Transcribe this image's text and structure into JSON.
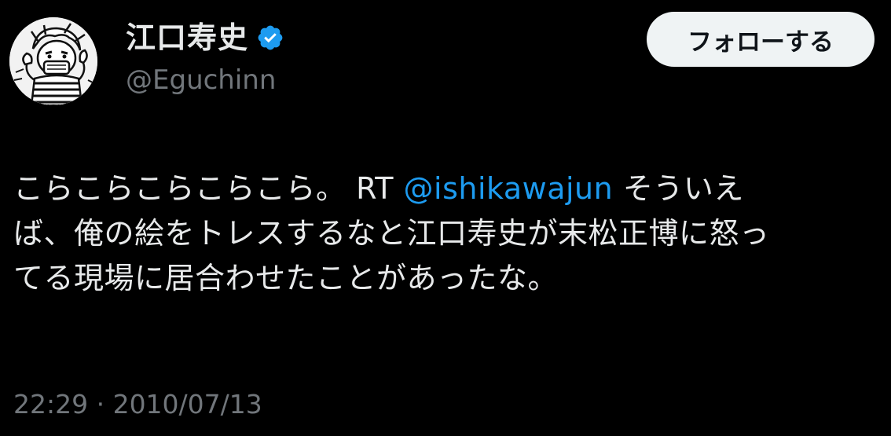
{
  "author": {
    "display_name": "江口寿史",
    "handle": "@Eguchinn",
    "avatar_icon": "manga-character-avatar",
    "verified_icon": "verified-badge-icon",
    "verified_color": "#1d9bf0"
  },
  "follow_button": {
    "label": "フォローする"
  },
  "tweet": {
    "line1_text": "こらこらこらこらこら。 RT ",
    "line1_mention": "@ishikawajun",
    "line1_tail": " そういえ",
    "line2": "ば、俺の絵をトレスするなと江口寿史が末松正博に怒っ",
    "line3": "てる現場に居合わせたことがあったな。"
  },
  "timestamp": "22:29 · 2010/07/13",
  "colors": {
    "background": "#000000",
    "text": "#e7e9ea",
    "secondary_text": "#71767b",
    "link": "#1d9bf0",
    "button_bg": "#eff3f4",
    "button_text": "#0f1419"
  }
}
